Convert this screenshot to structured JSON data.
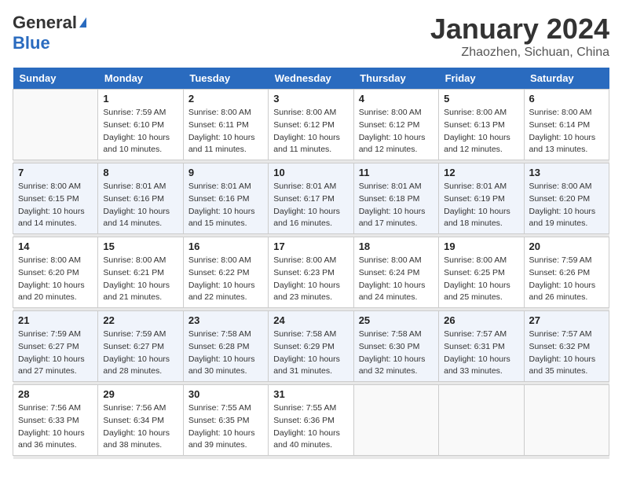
{
  "header": {
    "logo_general": "General",
    "logo_blue": "Blue",
    "month_title": "January 2024",
    "location": "Zhaozhen, Sichuan, China"
  },
  "days_of_week": [
    "Sunday",
    "Monday",
    "Tuesday",
    "Wednesday",
    "Thursday",
    "Friday",
    "Saturday"
  ],
  "weeks": [
    [
      {
        "date": "",
        "info": ""
      },
      {
        "date": "1",
        "info": "Sunrise: 7:59 AM\nSunset: 6:10 PM\nDaylight: 10 hours\nand 10 minutes."
      },
      {
        "date": "2",
        "info": "Sunrise: 8:00 AM\nSunset: 6:11 PM\nDaylight: 10 hours\nand 11 minutes."
      },
      {
        "date": "3",
        "info": "Sunrise: 8:00 AM\nSunset: 6:12 PM\nDaylight: 10 hours\nand 11 minutes."
      },
      {
        "date": "4",
        "info": "Sunrise: 8:00 AM\nSunset: 6:12 PM\nDaylight: 10 hours\nand 12 minutes."
      },
      {
        "date": "5",
        "info": "Sunrise: 8:00 AM\nSunset: 6:13 PM\nDaylight: 10 hours\nand 12 minutes."
      },
      {
        "date": "6",
        "info": "Sunrise: 8:00 AM\nSunset: 6:14 PM\nDaylight: 10 hours\nand 13 minutes."
      }
    ],
    [
      {
        "date": "7",
        "info": "Sunrise: 8:00 AM\nSunset: 6:15 PM\nDaylight: 10 hours\nand 14 minutes."
      },
      {
        "date": "8",
        "info": "Sunrise: 8:01 AM\nSunset: 6:16 PM\nDaylight: 10 hours\nand 14 minutes."
      },
      {
        "date": "9",
        "info": "Sunrise: 8:01 AM\nSunset: 6:16 PM\nDaylight: 10 hours\nand 15 minutes."
      },
      {
        "date": "10",
        "info": "Sunrise: 8:01 AM\nSunset: 6:17 PM\nDaylight: 10 hours\nand 16 minutes."
      },
      {
        "date": "11",
        "info": "Sunrise: 8:01 AM\nSunset: 6:18 PM\nDaylight: 10 hours\nand 17 minutes."
      },
      {
        "date": "12",
        "info": "Sunrise: 8:01 AM\nSunset: 6:19 PM\nDaylight: 10 hours\nand 18 minutes."
      },
      {
        "date": "13",
        "info": "Sunrise: 8:00 AM\nSunset: 6:20 PM\nDaylight: 10 hours\nand 19 minutes."
      }
    ],
    [
      {
        "date": "14",
        "info": "Sunrise: 8:00 AM\nSunset: 6:20 PM\nDaylight: 10 hours\nand 20 minutes."
      },
      {
        "date": "15",
        "info": "Sunrise: 8:00 AM\nSunset: 6:21 PM\nDaylight: 10 hours\nand 21 minutes."
      },
      {
        "date": "16",
        "info": "Sunrise: 8:00 AM\nSunset: 6:22 PM\nDaylight: 10 hours\nand 22 minutes."
      },
      {
        "date": "17",
        "info": "Sunrise: 8:00 AM\nSunset: 6:23 PM\nDaylight: 10 hours\nand 23 minutes."
      },
      {
        "date": "18",
        "info": "Sunrise: 8:00 AM\nSunset: 6:24 PM\nDaylight: 10 hours\nand 24 minutes."
      },
      {
        "date": "19",
        "info": "Sunrise: 8:00 AM\nSunset: 6:25 PM\nDaylight: 10 hours\nand 25 minutes."
      },
      {
        "date": "20",
        "info": "Sunrise: 7:59 AM\nSunset: 6:26 PM\nDaylight: 10 hours\nand 26 minutes."
      }
    ],
    [
      {
        "date": "21",
        "info": "Sunrise: 7:59 AM\nSunset: 6:27 PM\nDaylight: 10 hours\nand 27 minutes."
      },
      {
        "date": "22",
        "info": "Sunrise: 7:59 AM\nSunset: 6:27 PM\nDaylight: 10 hours\nand 28 minutes."
      },
      {
        "date": "23",
        "info": "Sunrise: 7:58 AM\nSunset: 6:28 PM\nDaylight: 10 hours\nand 30 minutes."
      },
      {
        "date": "24",
        "info": "Sunrise: 7:58 AM\nSunset: 6:29 PM\nDaylight: 10 hours\nand 31 minutes."
      },
      {
        "date": "25",
        "info": "Sunrise: 7:58 AM\nSunset: 6:30 PM\nDaylight: 10 hours\nand 32 minutes."
      },
      {
        "date": "26",
        "info": "Sunrise: 7:57 AM\nSunset: 6:31 PM\nDaylight: 10 hours\nand 33 minutes."
      },
      {
        "date": "27",
        "info": "Sunrise: 7:57 AM\nSunset: 6:32 PM\nDaylight: 10 hours\nand 35 minutes."
      }
    ],
    [
      {
        "date": "28",
        "info": "Sunrise: 7:56 AM\nSunset: 6:33 PM\nDaylight: 10 hours\nand 36 minutes."
      },
      {
        "date": "29",
        "info": "Sunrise: 7:56 AM\nSunset: 6:34 PM\nDaylight: 10 hours\nand 38 minutes."
      },
      {
        "date": "30",
        "info": "Sunrise: 7:55 AM\nSunset: 6:35 PM\nDaylight: 10 hours\nand 39 minutes."
      },
      {
        "date": "31",
        "info": "Sunrise: 7:55 AM\nSunset: 6:36 PM\nDaylight: 10 hours\nand 40 minutes."
      },
      {
        "date": "",
        "info": ""
      },
      {
        "date": "",
        "info": ""
      },
      {
        "date": "",
        "info": ""
      }
    ]
  ]
}
